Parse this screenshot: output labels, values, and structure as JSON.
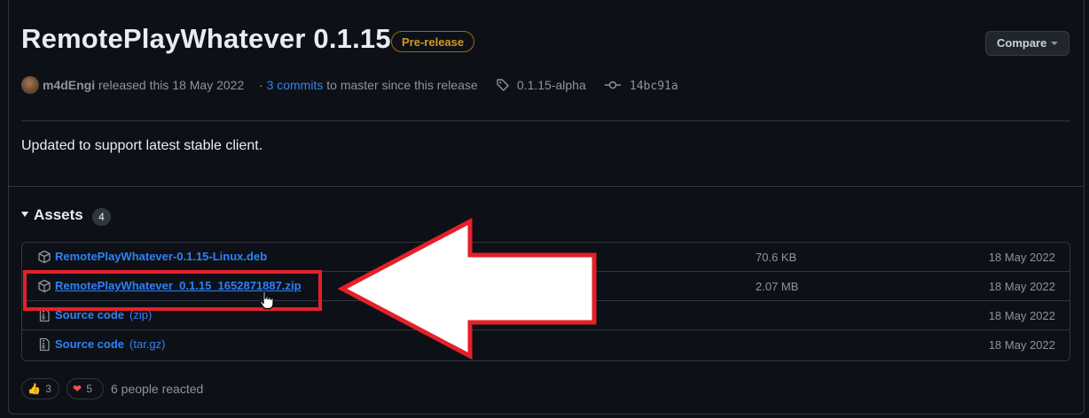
{
  "release": {
    "title": "RemotePlayWhatever 0.1.15",
    "badge": "Pre-release",
    "compare_label": "Compare",
    "author": "m4dEngi",
    "released_text": "released this 18 May 2022",
    "commits_prefix": "·",
    "commits_link": "3 commits",
    "commits_suffix": "to master since this release",
    "tag": "0.1.15-alpha",
    "commit_hash": "14bc91a",
    "body": "Updated to support latest stable client."
  },
  "assets": {
    "heading": "Assets",
    "count": "4",
    "items": [
      {
        "name": "RemotePlayWhatever-0.1.15-Linux.deb",
        "ext": "",
        "size": "70.6 KB",
        "date": "18 May 2022",
        "icon": "package-icon"
      },
      {
        "name": "RemotePlayWhatever_0.1.15_1652871887.zip",
        "ext": "",
        "size": "2.07 MB",
        "date": "18 May 2022",
        "icon": "package-icon"
      },
      {
        "name": "Source code",
        "ext": "(zip)",
        "size": "",
        "date": "18 May 2022",
        "icon": "file-zip-icon"
      },
      {
        "name": "Source code",
        "ext": "(tar.gz)",
        "size": "",
        "date": "18 May 2022",
        "icon": "file-zip-icon"
      }
    ]
  },
  "reactions": {
    "thumbs_up": {
      "emoji": "👍",
      "count": "3"
    },
    "heart": {
      "emoji": "❤",
      "count": "5"
    },
    "summary": "6 people reacted"
  },
  "annotation": {
    "highlight_color": "#e5202a",
    "arrow_color": "#e5202a"
  }
}
